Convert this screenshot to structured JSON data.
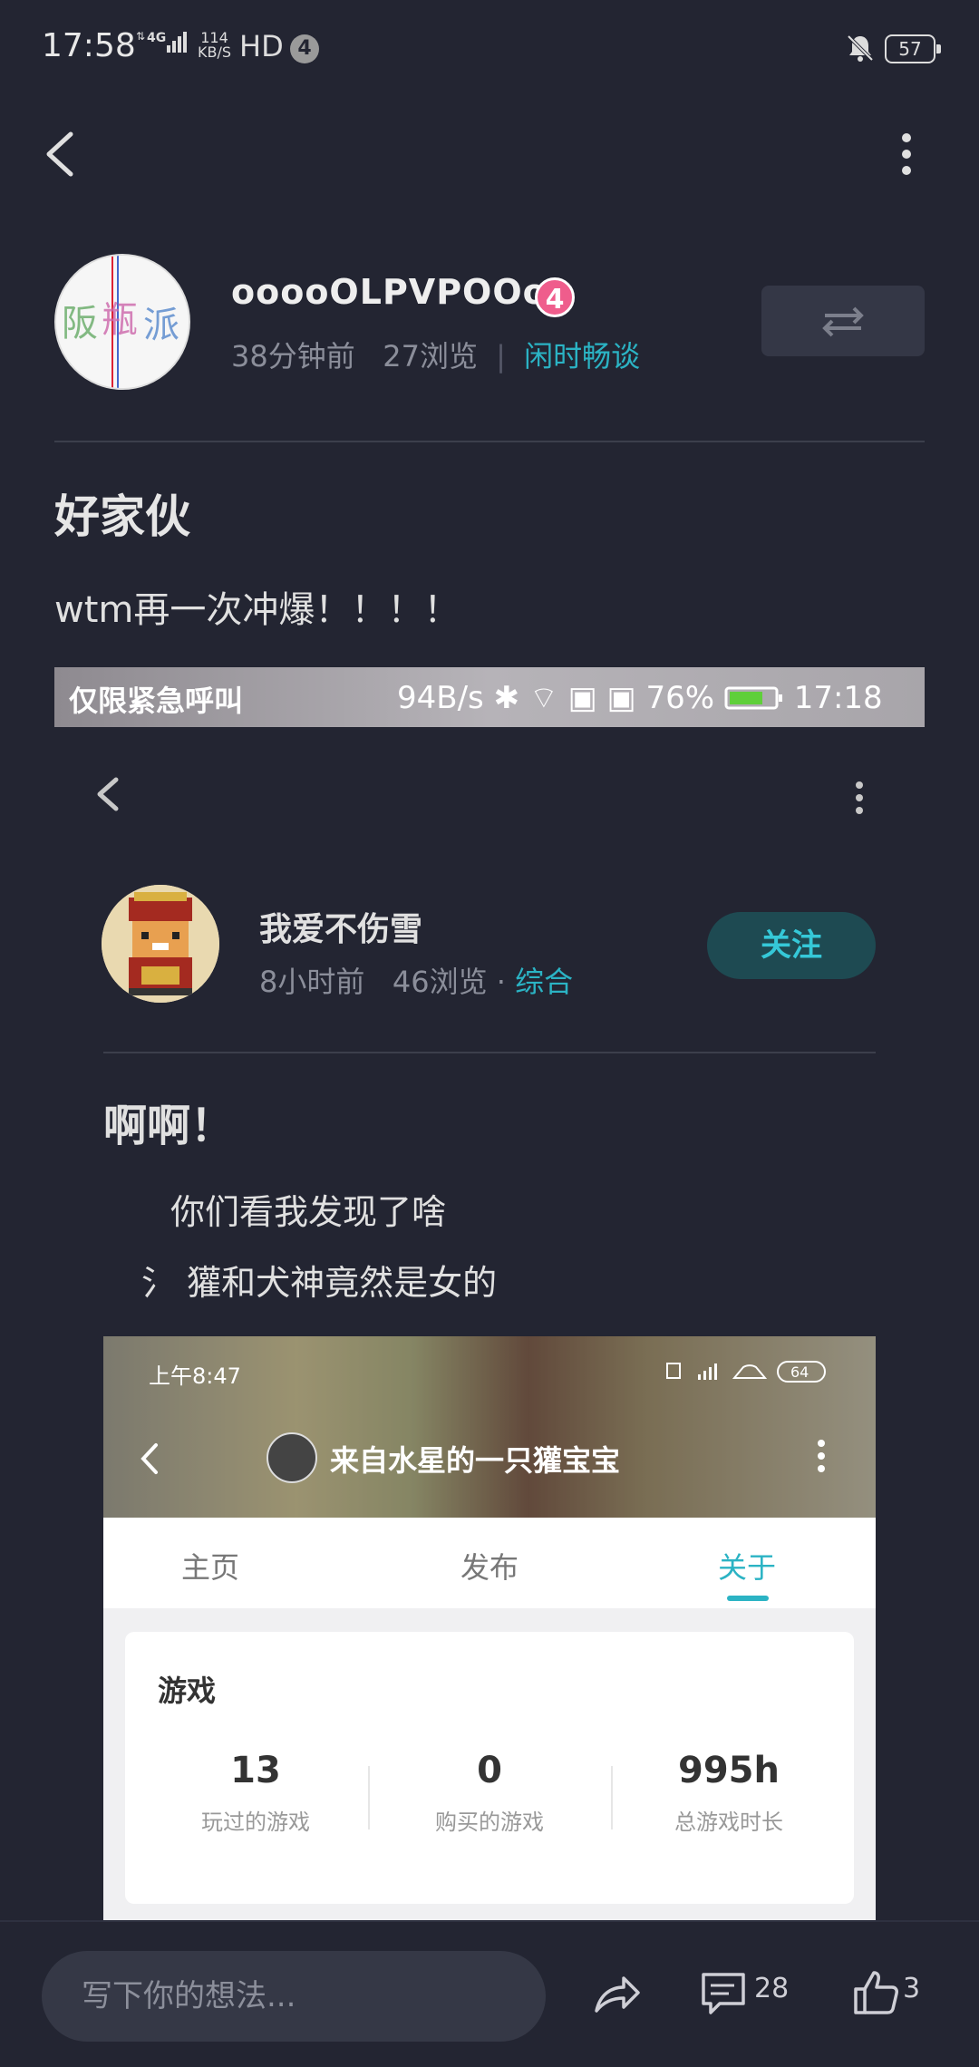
{
  "status_bar": {
    "time": "17:58",
    "network": "4G",
    "speed_value": "114",
    "speed_unit": "KB/S",
    "hd": "HD",
    "notif_count": "4",
    "battery": "57"
  },
  "author": {
    "name": "ooooOLPVPOOoo",
    "level": "4",
    "time_ago": "38分钟前",
    "views": "27浏览",
    "category": "闲时畅谈"
  },
  "post": {
    "title": "好家伙",
    "body": "wtm再一次冲爆！！！！"
  },
  "embedded": {
    "status_left": "仅限紧急呼叫",
    "status_right": "94B/s  ✱  ⌔  ▣  ▣  76%",
    "status_time": "17:18",
    "author_name": "我爱不伤雪",
    "time_ago": "8小时前",
    "views": "46浏览",
    "category": "综合",
    "follow_label": "关注",
    "title": "啊啊！",
    "line1": "你们看我发现了啥",
    "line2_prefix": "氵",
    "line2": "獾和犬神竟然是女的",
    "nested": {
      "time": "上午8:47",
      "battery": "64",
      "profile_title": "来自水星的一只獾宝宝",
      "tabs": [
        "主页",
        "发布",
        "关于"
      ],
      "card_title": "游戏",
      "stats": [
        {
          "value": "13",
          "label": "玩过的游戏"
        },
        {
          "value": "0",
          "label": "购买的游戏"
        },
        {
          "value": "995h",
          "label": "总游戏时长"
        }
      ]
    }
  },
  "bottom": {
    "input_placeholder": "写下你的想法...",
    "comment_count": "28",
    "like_count": "3"
  },
  "colors": {
    "background": "#232532",
    "accent": "#2bb3c4",
    "level_badge": "#ef5d8c"
  }
}
